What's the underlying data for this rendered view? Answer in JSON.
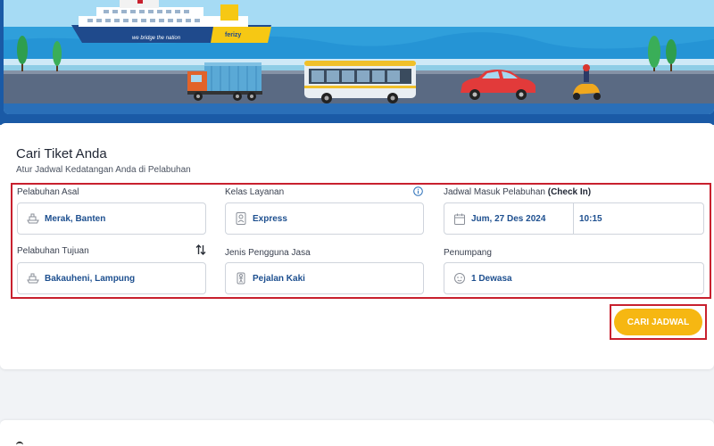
{
  "banner": {
    "ship_slogan": "we bridge the nation",
    "ship_brand": "ferizy"
  },
  "search_card": {
    "title": "Cari Tiket Anda",
    "subtitle": "Atur Jadwal Kedatangan Anda di Pelabuhan"
  },
  "fields": {
    "origin": {
      "label": "Pelabuhan Asal",
      "value": "Merak, Banten",
      "icon": "ship-icon"
    },
    "destination": {
      "label": "Pelabuhan Tujuan",
      "value": "Bakauheni, Lampung",
      "icon": "ship-icon"
    },
    "service_class": {
      "label": "Kelas Layanan",
      "value": "Express",
      "icon": "service-class-icon"
    },
    "user_type": {
      "label": "Jenis Pengguna Jasa",
      "value": "Pejalan Kaki",
      "icon": "pedestrian-icon"
    },
    "schedule": {
      "label": "Jadwal Masuk Pelabuhan",
      "label_bold": "(Check In)",
      "date": "Jum, 27 Des 2024",
      "time": "10:15",
      "icon": "calendar-icon"
    },
    "passengers": {
      "label": "Penumpang",
      "value": "1 Dewasa",
      "icon": "passenger-icon"
    }
  },
  "actions": {
    "search_label": "CARI JADWAL"
  },
  "colors": {
    "primary_blue": "#1a5aa6",
    "value_blue": "#1d4f8f",
    "accent_yellow": "#f6b712",
    "highlight_red": "#c8202e"
  }
}
